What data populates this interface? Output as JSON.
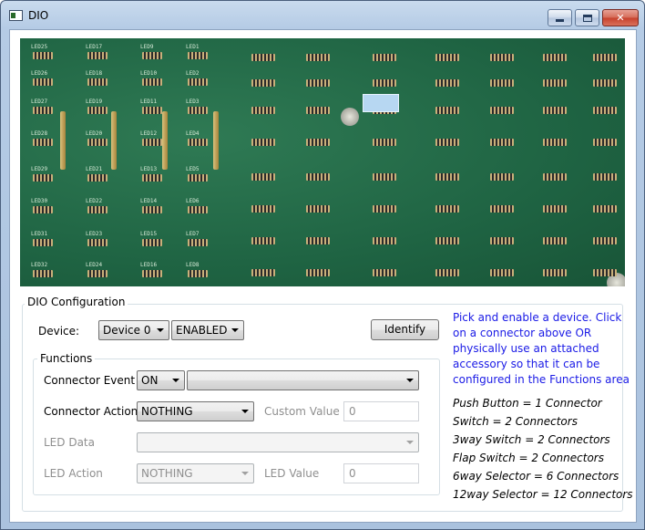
{
  "window": {
    "title": "DIO"
  },
  "board": {
    "col_labels": [
      [
        "LED25",
        "LED26",
        "LED27",
        "LED28",
        "LED29",
        "LED30",
        "LED31",
        "LED32"
      ],
      [
        "LED17",
        "LED18",
        "LED19",
        "LED20",
        "LED21",
        "LED22",
        "LED23",
        "LED24"
      ],
      [
        "LED9",
        "LED10",
        "LED11",
        "LED12",
        "LED13",
        "LED14",
        "LED15",
        "LED16"
      ],
      [
        "LED1",
        "LED2",
        "LED3",
        "LED4",
        "LED5",
        "LED6",
        "LED7",
        "LED8"
      ]
    ]
  },
  "dio_config": {
    "group_label": "DIO Configuration",
    "device_label": "Device:",
    "device_value": "Device 0",
    "state_value": "ENABLED",
    "identify_label": "Identify",
    "info_text": "Pick and enable a device. Click on a connector above OR physically use an attached accessory so that it can be configured in the Functions area",
    "legend": [
      "Push Button = 1 Connector",
      "Switch = 2 Connectors",
      "3way Switch = 2 Connectors",
      "Flap Switch = 2 Connectors",
      "6way Selector = 6 Connectors",
      "12way Selector = 12 Connectors"
    ]
  },
  "functions": {
    "group_label": "Functions",
    "connector_event_label": "Connector Event",
    "connector_event_value": "ON",
    "connector_event_detail": "",
    "connector_action_label": "Connector Action",
    "connector_action_value": "NOTHING",
    "custom_value_label": "Custom Value",
    "custom_value": "0",
    "led_data_label": "LED Data",
    "led_data_value": "",
    "led_action_label": "LED Action",
    "led_action_value": "NOTHING",
    "led_value_label": "LED Value",
    "led_value": "0"
  },
  "colors": {
    "info_text": "#1a1ae6",
    "pcb": "#1f6443",
    "highlight": "#b7d7f2"
  }
}
